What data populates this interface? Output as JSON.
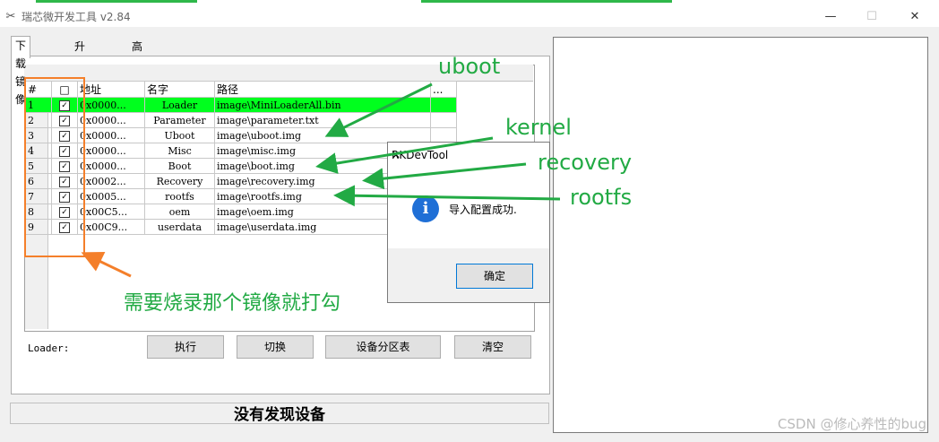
{
  "window": {
    "title": "瑞芯微开发工具 v2.84",
    "minimize": "—",
    "maximize": "☐",
    "close": "✕"
  },
  "tabs": [
    {
      "label": "下载镜像",
      "active": true
    },
    {
      "label": "升级固件",
      "active": false
    },
    {
      "label": "高级功能",
      "active": false
    }
  ],
  "grid": {
    "columns": [
      "#",
      "□",
      "地址",
      "名字",
      "路径",
      "..."
    ],
    "rows": [
      {
        "num": "1",
        "checked": "✓",
        "addr": "0x0000...",
        "name": "Loader",
        "path": "image\\MiniLoaderAll.bin"
      },
      {
        "num": "2",
        "checked": "✓",
        "addr": "0x0000...",
        "name": "Parameter",
        "path": "image\\parameter.txt"
      },
      {
        "num": "3",
        "checked": "✓",
        "addr": "0x0000...",
        "name": "Uboot",
        "path": "image\\uboot.img"
      },
      {
        "num": "4",
        "checked": "✓",
        "addr": "0x0000...",
        "name": "Misc",
        "path": "image\\misc.img"
      },
      {
        "num": "5",
        "checked": "✓",
        "addr": "0x0000...",
        "name": "Boot",
        "path": "image\\boot.img"
      },
      {
        "num": "6",
        "checked": "✓",
        "addr": "0x0002...",
        "name": "Recovery",
        "path": "image\\recovery.img"
      },
      {
        "num": "7",
        "checked": "✓",
        "addr": "0x0005...",
        "name": "rootfs",
        "path": "image\\rootfs.img"
      },
      {
        "num": "8",
        "checked": "✓",
        "addr": "0x00C5...",
        "name": "oem",
        "path": "image\\oem.img"
      },
      {
        "num": "9",
        "checked": "✓",
        "addr": "0x00C9...",
        "name": "userdata",
        "path": "image\\userdata.img"
      }
    ]
  },
  "loader_label": "Loader:",
  "buttons": {
    "run": "执行",
    "switch": "切换",
    "partition": "设备分区表",
    "clear": "清空"
  },
  "status": "没有发现设备",
  "dialog": {
    "title": "RKDevTool",
    "close": "✕",
    "icon": "i",
    "message": "导入配置成功.",
    "ok": "确定"
  },
  "annotations": {
    "uboot": "uboot",
    "kernel": "kernel",
    "recovery": "recovery",
    "rootfs": "rootfs",
    "check_hint": "需要烧录那个镜像就打勾"
  },
  "colors": {
    "selected_row": "#00ff1e",
    "annotation_green": "#22aa44",
    "annotation_orange": "#f47f2a",
    "info_blue": "#1f6fd6"
  },
  "watermark": "CSDN @修心养性的bug"
}
